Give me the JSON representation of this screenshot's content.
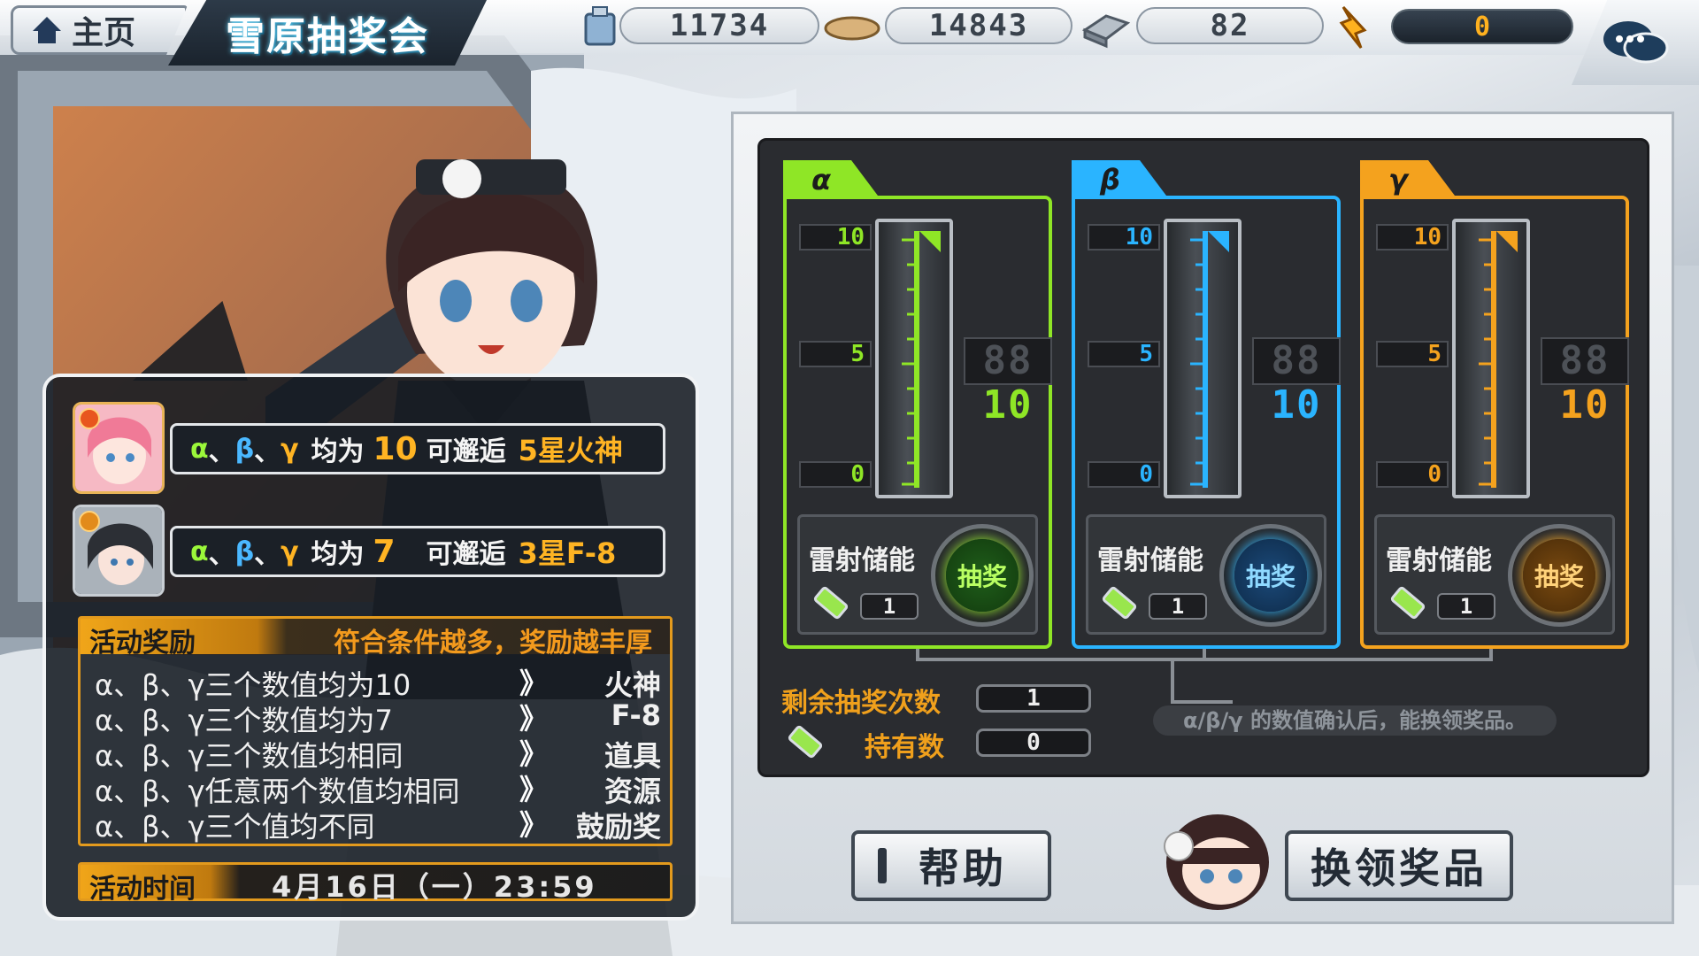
{
  "header": {
    "home_label": "主页",
    "title": "雪原抽奖会",
    "resources": [
      {
        "icon": "ammo-box-icon",
        "value": "11734"
      },
      {
        "icon": "ration-icon",
        "value": "14843"
      },
      {
        "icon": "steel-icon",
        "value": "82"
      }
    ],
    "aluminum": {
      "icon": "aluminum-icon",
      "value": "0"
    }
  },
  "info": {
    "rewards": [
      {
        "cond_num": "10",
        "prefix": "均为",
        "mid": "可邂逅",
        "star": "5星火神"
      },
      {
        "cond_num": "7",
        "prefix": "均为",
        "mid": "可邂逅",
        "star": "3星F-8"
      }
    ],
    "greek": {
      "a": "α",
      "b": "β",
      "y": "γ",
      "sep": "、"
    },
    "reward_box": {
      "title": "活动奖励",
      "subtitle": "符合条件越多，奖励越丰厚",
      "rules": [
        {
          "cond": "α、β、γ三个数值均为10",
          "prize": "火神"
        },
        {
          "cond": "α、β、γ三个数值均为7",
          "prize": "F-8"
        },
        {
          "cond": "α、β、γ三个数值均相同",
          "prize": "道具"
        },
        {
          "cond": "α、β、γ任意两个数值均相同",
          "prize": "资源"
        },
        {
          "cond": "α、β、γ三个值均不同",
          "prize": "鼓励奖"
        }
      ],
      "arrow": "》"
    },
    "time_label": "活动时间",
    "time_value": "4月16日（一）23:59"
  },
  "machine": {
    "columns": [
      {
        "label": "α",
        "color": "#8fe626",
        "marks": [
          "10",
          "5",
          "0"
        ],
        "ghost": "88",
        "value": "10",
        "laser": "雷射储能",
        "count": "1",
        "button": "抽奖"
      },
      {
        "label": "β",
        "color": "#2ab4ff",
        "marks": [
          "10",
          "5",
          "0"
        ],
        "ghost": "88",
        "value": "10",
        "laser": "雷射储能",
        "count": "1",
        "button": "抽奖"
      },
      {
        "label": "γ",
        "color": "#f4a21e",
        "marks": [
          "10",
          "5",
          "0"
        ],
        "ghost": "88",
        "value": "10",
        "laser": "雷射储能",
        "count": "1",
        "button": "抽奖"
      }
    ],
    "remaining_label": "剩余抽奖次数",
    "remaining_value": "1",
    "held_label": "持有数",
    "held_value": "0",
    "notice": "α/β/γ 的数值确认后，能换领奖品。"
  },
  "buttons": {
    "help": "帮助",
    "redeem": "换领奖品"
  }
}
